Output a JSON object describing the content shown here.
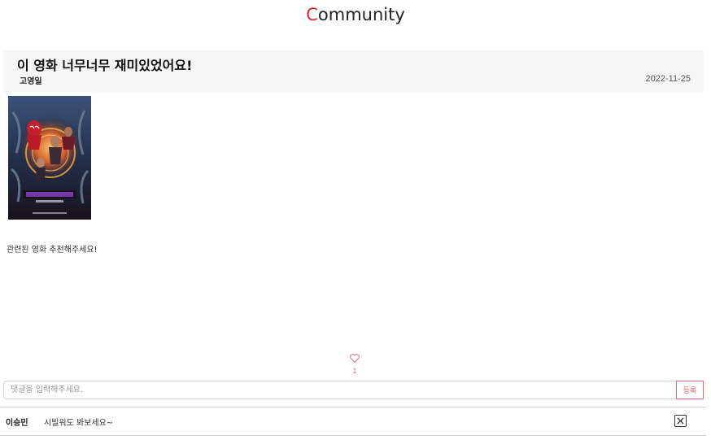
{
  "header": {
    "title_first": "C",
    "title_rest": "ommunity"
  },
  "post": {
    "title": "이 영화 너무너무 재미있었어요!",
    "author": "고영일",
    "date": "2022-11-25",
    "poster_icon": "movie-poster-image",
    "body": "관련된 영화 추천해주세요!"
  },
  "like": {
    "icon": "heart-icon",
    "count": "1",
    "color": "#e8677a"
  },
  "comment_form": {
    "placeholder": "댓글을 입력해주세요.",
    "submit_label": "등록"
  },
  "comments": [
    {
      "author": "이승민",
      "text": "시빌워도 봐보세요~",
      "delete_icon": "close-box-icon"
    }
  ],
  "colors": {
    "accent": "#e0242b",
    "pink": "#e8677a",
    "header_bg": "#f6f6f6"
  }
}
